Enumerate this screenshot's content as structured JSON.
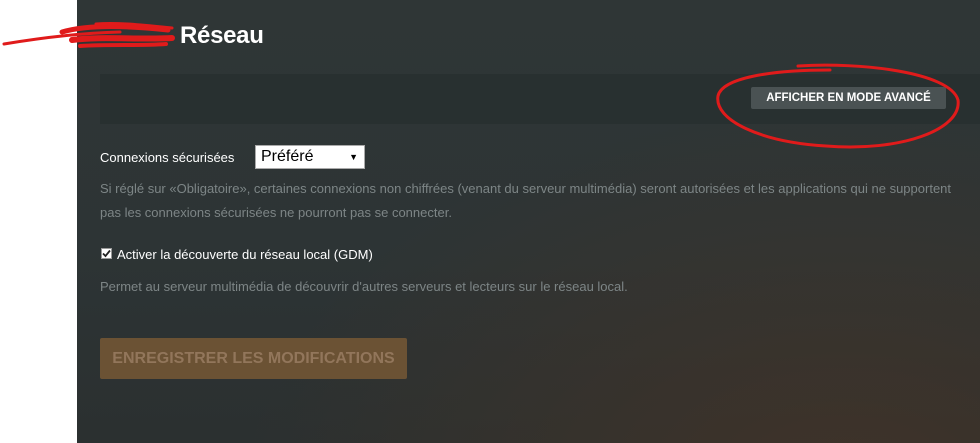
{
  "page": {
    "title": "Réseau"
  },
  "toolbar": {
    "advanced_button": "AFFICHER EN MODE AVANCÉ"
  },
  "secure_connections": {
    "label": "Connexions sécurisées",
    "selected": "Préféré",
    "help": "Si réglé sur «Obligatoire», certaines connexions non chiffrées (venant du serveur multimédia) seront autorisées et les applications qui ne supportent pas les connexions sécurisées ne pourront pas se connecter."
  },
  "gdm": {
    "checked": true,
    "label": "Activer la découverte du réseau local (GDM)",
    "help": "Permet au serveur multimédia de découvrir d'autres serveurs et lecteurs sur le réseau local."
  },
  "save_button": "ENREGISTRER LES MODIFICATIONS",
  "colors": {
    "annotation": "#e01b1b",
    "save_button_bg": "#6b5234",
    "panel_bg": "#2d3435"
  },
  "icons": {
    "checkbox": "checkmark-icon",
    "select": "caret-down-icon"
  }
}
